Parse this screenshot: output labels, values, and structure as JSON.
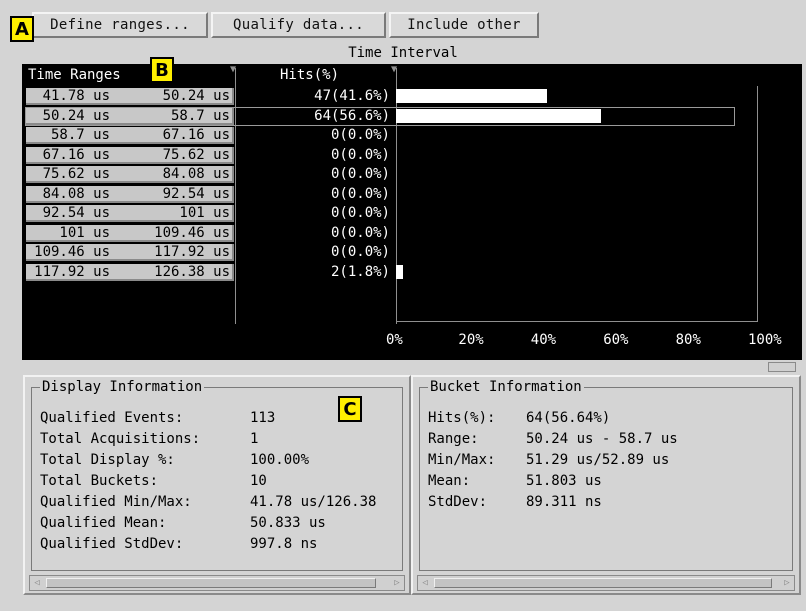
{
  "toolbar": {
    "define_ranges": "Define ranges...",
    "qualify_data": "Qualify data...",
    "include_other": "Include other"
  },
  "callouts": {
    "a": "A",
    "b": "B",
    "c": "C"
  },
  "histogram": {
    "title": "Time Interval",
    "col_ranges": "Time Ranges",
    "col_hits": "Hits(%)",
    "rows": [
      {
        "lo": "41.78 us",
        "hi": "50.24 us",
        "hits": "47(41.6%)",
        "pct": 41.6
      },
      {
        "lo": "50.24 us",
        "hi": "58.7 us",
        "hits": "64(56.6%)",
        "pct": 56.6
      },
      {
        "lo": "58.7 us",
        "hi": "67.16 us",
        "hits": "0(0.0%)",
        "pct": 0
      },
      {
        "lo": "67.16 us",
        "hi": "75.62 us",
        "hits": "0(0.0%)",
        "pct": 0
      },
      {
        "lo": "75.62 us",
        "hi": "84.08 us",
        "hits": "0(0.0%)",
        "pct": 0
      },
      {
        "lo": "84.08 us",
        "hi": "92.54 us",
        "hits": "0(0.0%)",
        "pct": 0
      },
      {
        "lo": "92.54 us",
        "hi": "101 us",
        "hits": "0(0.0%)",
        "pct": 0
      },
      {
        "lo": "101 us",
        "hi": "109.46 us",
        "hits": "0(0.0%)",
        "pct": 0
      },
      {
        "lo": "109.46 us",
        "hi": "117.92 us",
        "hits": "0(0.0%)",
        "pct": 0
      },
      {
        "lo": "117.92 us",
        "hi": "126.38 us",
        "hits": "2(1.8%)",
        "pct": 1.8
      }
    ],
    "selected_row": 1,
    "axis": [
      "0%",
      "20%",
      "40%",
      "60%",
      "80%",
      "100%"
    ]
  },
  "display_info": {
    "title": "Display Information",
    "items": [
      {
        "label": "Qualified Events:",
        "value": "113"
      },
      {
        "label": "Total Acquisitions:",
        "value": "1"
      },
      {
        "label": "Total Display %:",
        "value": "100.00%"
      },
      {
        "label": "Total Buckets:",
        "value": "10"
      },
      {
        "label": "Qualified Min/Max:",
        "value": "41.78 us/126.38"
      },
      {
        "label": "Qualified Mean:",
        "value": "50.833 us"
      },
      {
        "label": "Qualified StdDev:",
        "value": "997.8 ns"
      }
    ]
  },
  "bucket_info": {
    "title": "Bucket Information",
    "items": [
      {
        "label": "Hits(%):",
        "value": "64(56.64%)"
      },
      {
        "label": "Range:",
        "value": "50.24 us - 58.7 us"
      },
      {
        "label": "Min/Max:",
        "value": "51.29 us/52.89 us"
      },
      {
        "label": "Mean:",
        "value": "51.803 us"
      },
      {
        "label": "StdDev:",
        "value": "89.311 ns"
      }
    ]
  },
  "colors": {
    "background": "#d4d4d4",
    "plot_bg": "#000000",
    "callout": "#ffef00"
  }
}
